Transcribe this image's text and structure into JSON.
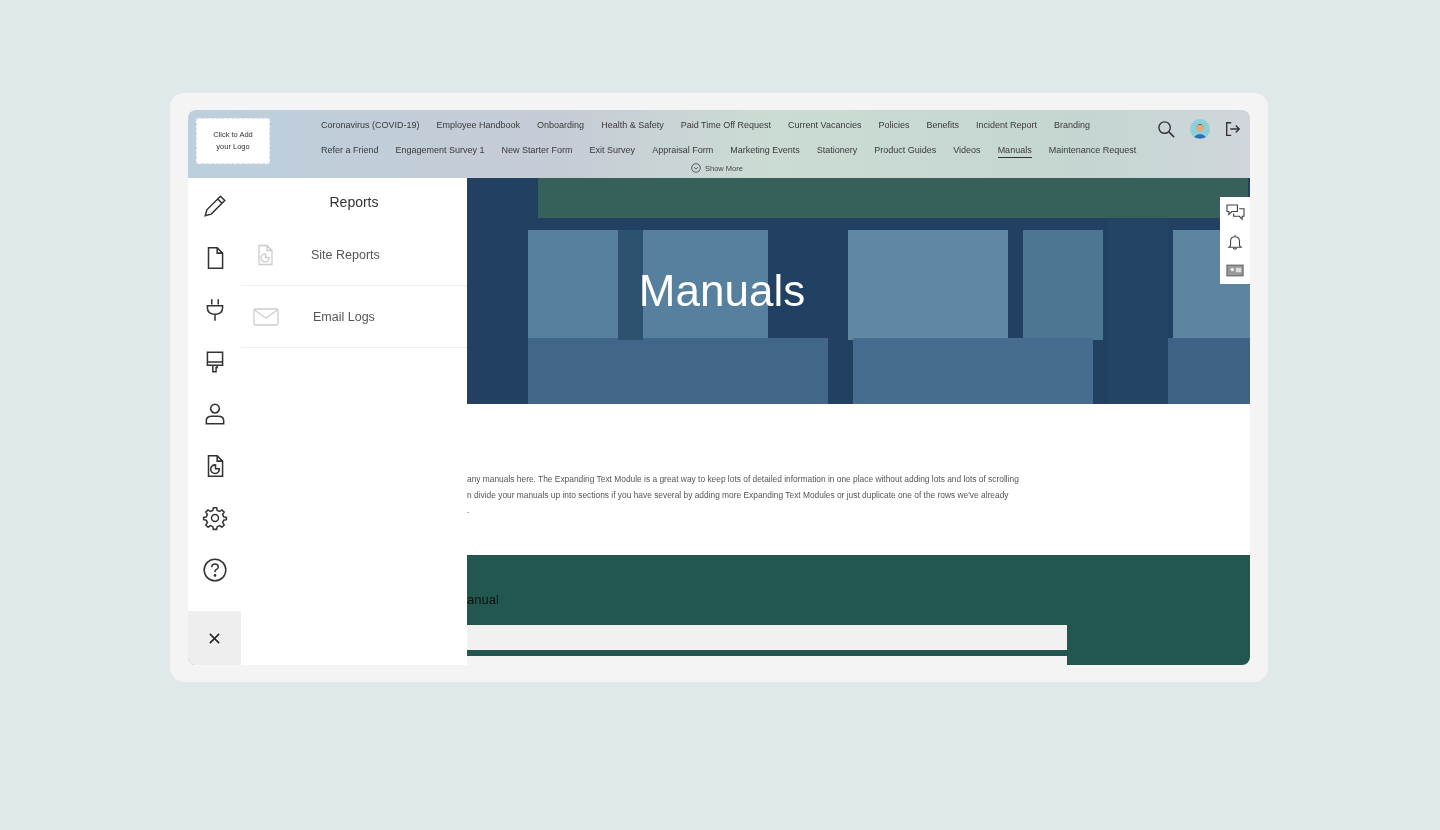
{
  "logo": {
    "text": "Click to Add your Logo"
  },
  "nav": {
    "links": [
      {
        "label": "Coronavirus (COVID-19)",
        "selected": false
      },
      {
        "label": "Employee Handbook",
        "selected": false
      },
      {
        "label": "Onboarding",
        "selected": false
      },
      {
        "label": "Health & Safety",
        "selected": false
      },
      {
        "label": "Paid Time Off Request",
        "selected": false
      },
      {
        "label": "Current Vacancies",
        "selected": false
      },
      {
        "label": "Policies",
        "selected": false
      },
      {
        "label": "Benefits",
        "selected": false
      },
      {
        "label": "Incident Report",
        "selected": false
      },
      {
        "label": "Branding",
        "selected": false
      },
      {
        "label": "Refer a Friend",
        "selected": false
      },
      {
        "label": "Engagement Survey 1",
        "selected": false
      },
      {
        "label": "New Starter Form",
        "selected": false
      },
      {
        "label": "Exit Survey",
        "selected": false
      },
      {
        "label": "Appraisal Form",
        "selected": false
      },
      {
        "label": "Marketing Events",
        "selected": false
      },
      {
        "label": "Stationery",
        "selected": false
      },
      {
        "label": "Product Guides",
        "selected": false
      },
      {
        "label": "Videos",
        "selected": false
      },
      {
        "label": "Manuals",
        "selected": true
      },
      {
        "label": "Maintenance Request",
        "selected": false
      }
    ],
    "show_more": "Show More"
  },
  "hero": {
    "title": "Manuals"
  },
  "body_text": [
    "any manuals here. The Expanding Text Module is a great way to keep lots of detailed information in one place without adding lots and lots of scrolling",
    "n divide your manuals up into sections if you have several by adding more Expanding Text Modules or just duplicate one of the rows we've already",
    "."
  ],
  "section": {
    "heading": "anual"
  },
  "panel": {
    "title": "Reports",
    "items": [
      {
        "label": "Site Reports",
        "kind": "report"
      },
      {
        "label": "Email Logs",
        "kind": "mail"
      }
    ]
  }
}
